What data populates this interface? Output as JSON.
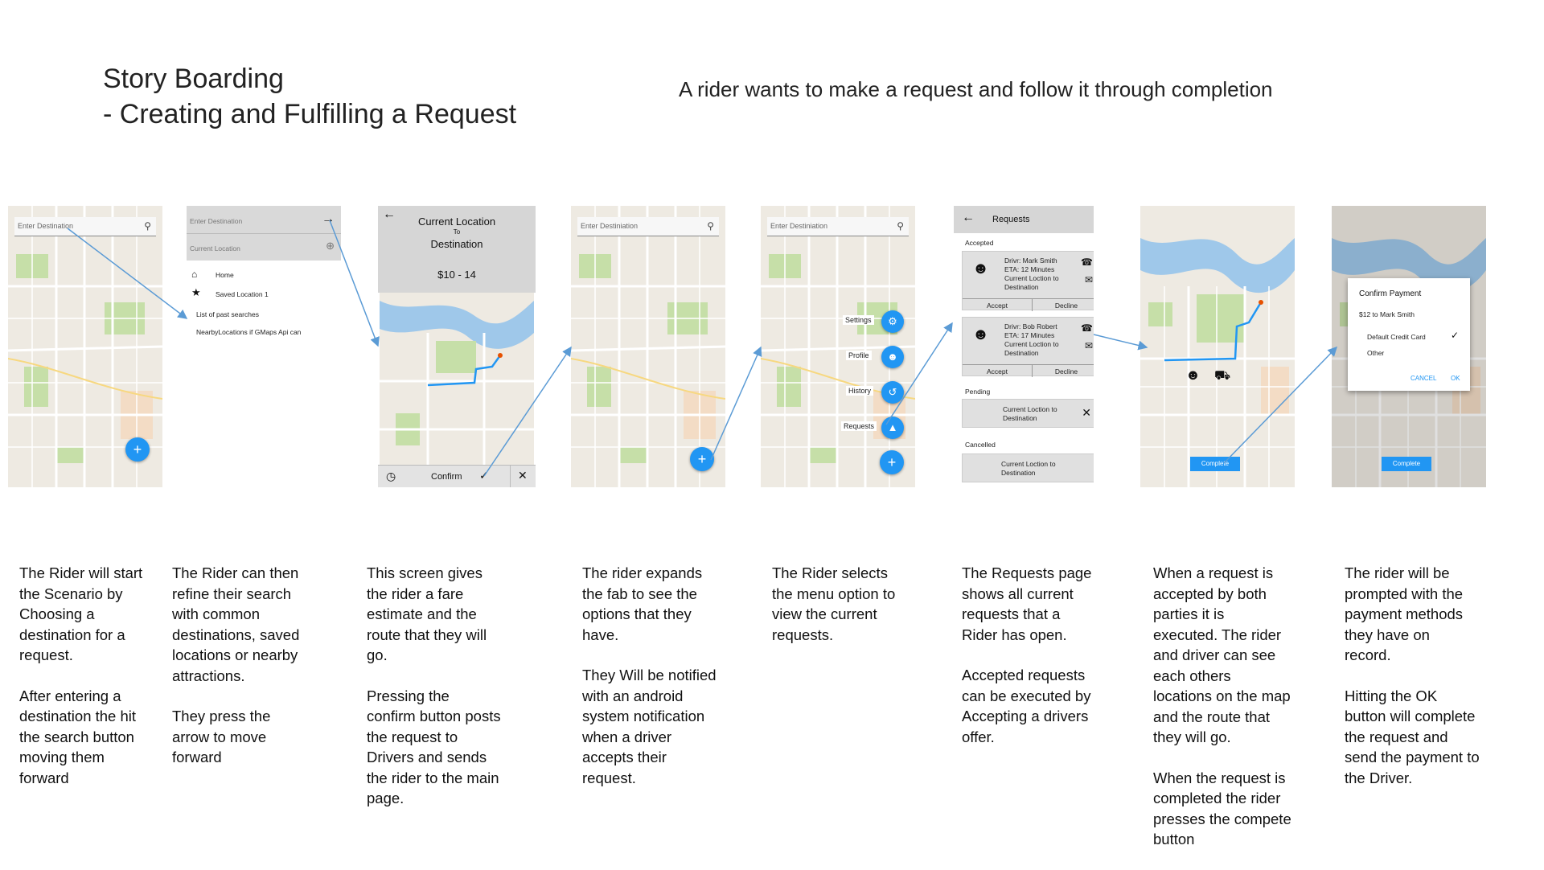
{
  "title": {
    "line1": "Story Boarding",
    "line2": "- Creating and Fulfilling a Request"
  },
  "subtitle": "A rider wants to make a request and follow it through completion",
  "screens": {
    "s1": {
      "search_placeholder": "Enter Destination"
    },
    "s2": {
      "destination_placeholder": "Enter Destination",
      "current_placeholder": "Current Location",
      "items": [
        "Home",
        "Saved Location 1",
        "List of past searches",
        "NearbyLocations if GMaps Api can"
      ]
    },
    "s3": {
      "line1": "Current Location",
      "line2": "To",
      "line3": "Destination",
      "fare": "$10 - 14",
      "confirm": "Confirm"
    },
    "s4": {
      "search_placeholder": "Enter Destiniation"
    },
    "s5": {
      "search_placeholder": "Enter Destiniation",
      "menu": [
        "Settings",
        "Profile",
        "History",
        "Requests"
      ]
    },
    "s6": {
      "title": "Requests",
      "accepted": "Accepted",
      "pending": "Pending",
      "cancelled": "Cancelled",
      "cards": [
        {
          "l1": "Drivr: Mark Smith",
          "l2": "ETA: 12 Minutes",
          "l3": "Current Loction to",
          "l4": "Destination"
        },
        {
          "l1": "Drivr: Bob Robert",
          "l2": "ETA: 17 Minutes",
          "l3": "Current Loction to",
          "l4": "Destination"
        }
      ],
      "accept": "Accept",
      "decline": "Decline",
      "pending_card": {
        "l1": "Current Loction to",
        "l2": "Destination"
      },
      "cancelled_card": {
        "l1": "Current Loction to",
        "l2": "Destination"
      }
    },
    "s7": {
      "complete": "Complete"
    },
    "s8": {
      "dialog_title": "Confirm Payment",
      "amount": "$12 to Mark Smith",
      "option1": "Default Credit Card",
      "option2": "Other",
      "cancel": "CANCEL",
      "ok": "OK",
      "complete": "Complete"
    }
  },
  "descriptions": [
    [
      "The Rider will start the Scenario by Choosing a destination for a request.",
      "After entering a destination the hit the search button moving them forward"
    ],
    [
      "The Rider can then refine their search with common destinations, saved locations or nearby attractions.",
      "They press the arrow to move forward"
    ],
    [
      "This screen gives the rider a fare estimate and the route that they will go.",
      "Pressing the confirm button posts the request to Drivers and sends the rider to the main page."
    ],
    [
      "The rider expands the fab to see the options that they have.",
      "They Will be notified with an android system notification when a driver accepts their request."
    ],
    [
      "The Rider selects the menu option to view the current requests."
    ],
    [
      "The Requests page shows all current requests that a Rider has open.",
      "Accepted requests can be executed by Accepting a drivers offer."
    ],
    [
      "When a request is accepted by both parties it is executed. The rider and driver can see each others locations on the map and the route that they will go.",
      "When the request is completed the rider presses the compete button"
    ],
    [
      "The rider will be prompted with the payment methods they have on record.",
      "Hitting the OK button will complete the request and send the payment to the Driver."
    ]
  ],
  "colors": {
    "accent": "#2196f3",
    "water": "#9fc8ea",
    "park": "#c6dfa8",
    "road": "#ffffff"
  }
}
